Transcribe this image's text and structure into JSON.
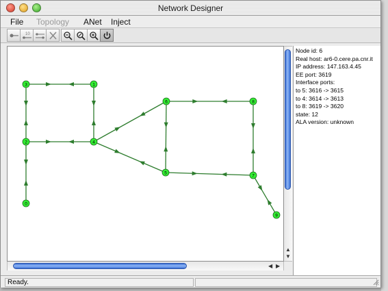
{
  "window": {
    "title": "Network Designer"
  },
  "menu": {
    "items": [
      {
        "label": "File",
        "enabled": true
      },
      {
        "label": "Topology",
        "enabled": false
      },
      {
        "label": "ANet",
        "enabled": true
      },
      {
        "label": "Inject",
        "enabled": true
      }
    ]
  },
  "toolbar": {
    "tools": [
      "add-node-icon",
      "add-link-icon",
      "add-multi-link-icon",
      "delete-icon",
      "zoom-out-icon",
      "zoom-reset-icon",
      "zoom-in-icon",
      "power-icon"
    ]
  },
  "graph": {
    "node_color": "#33ee33",
    "edge_color": "#2e7d2e",
    "nodes": [
      "3",
      "1",
      "6",
      "8",
      "2",
      "4",
      "7",
      "5",
      "0",
      "9"
    ],
    "edges": [
      [
        "1",
        "3"
      ],
      [
        "3",
        "2"
      ],
      [
        "1",
        "4"
      ],
      [
        "2",
        "4"
      ],
      [
        "2",
        "0"
      ],
      [
        "4",
        "6"
      ],
      [
        "4",
        "5"
      ],
      [
        "6",
        "8"
      ],
      [
        "6",
        "5"
      ],
      [
        "8",
        "7"
      ],
      [
        "5",
        "7"
      ],
      [
        "7",
        "9"
      ]
    ]
  },
  "info": {
    "lines": [
      "Node id: 6",
      "Real host: ar6-0.cere.pa.cnr.it",
      "IP address: 147.163.4.45",
      "EE port: 3619",
      "Interface ports:",
      "to 5: 3616 -> 3615",
      "to 4: 3614 -> 3613",
      "to 8: 3619 -> 3620",
      "state: 12",
      "ALA version: unknown"
    ]
  },
  "status": {
    "text": "Ready."
  }
}
